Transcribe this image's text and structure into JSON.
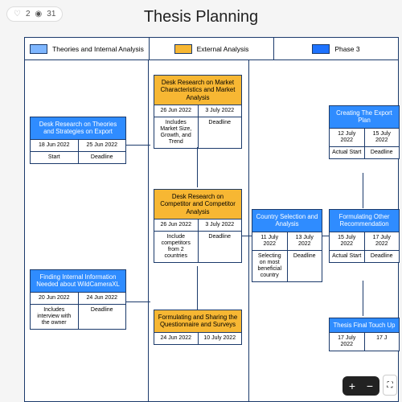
{
  "stats": {
    "likes": "2",
    "views": "31"
  },
  "title": "Thesis Planning",
  "legend": {
    "col1": "Theories and Internal Analysis",
    "col2": "External Analysis",
    "col3": "Phase 3"
  },
  "boxes": {
    "desk_export": {
      "title": "Desk Research on Theories and Strategies on Export",
      "d1": "18 Jun 2022",
      "d2": "25 Jun 2022",
      "l1": "Start",
      "l2": "Deadline"
    },
    "internal": {
      "title": "Finding Internal Information Needed about WildCameraXL",
      "d1": "20 Jun 2022",
      "d2": "24 Jun 2022",
      "l1": "Includes interview with the owner",
      "l2": "Deadline"
    },
    "market": {
      "title": "Desk Research on Market Characteristics and Market Analysis",
      "d1": "26 Jun 2022",
      "d2": "3 July 2022",
      "l1": "Includes Market Size, Growth, and Trend",
      "l2": "Deadline"
    },
    "competitor": {
      "title": "Desk Research on Competitor and Competitor Analysis",
      "d1": "26 Jun 2022",
      "d2": "3 July 2022",
      "l1": "Include competitors from 2 countries",
      "l2": "Deadline"
    },
    "survey": {
      "title": "Formulating and Sharing the Questionnaire and Surveys",
      "d1": "24 Jun 2022",
      "d2": "10 July 2022"
    },
    "country": {
      "title": "Country Selection and Analysis",
      "d1": "11 July 2022",
      "d2": "13 July 2022",
      "l1": "Selecting on most beneficial country",
      "l2": "Deadline"
    },
    "exportplan": {
      "title": "Creating The Export Plan",
      "d1": "12 July 2022",
      "d2": "15 July 2022",
      "l1": "Actual Start",
      "l2": "Deadline"
    },
    "other": {
      "title": "Formulating Other Recommendation",
      "d1": "15 July 2022",
      "d2": "17 July 2022",
      "l1": "Actual Start",
      "l2": "Deadline"
    },
    "final": {
      "title": "Thesis Final Touch Up",
      "d1": "17 July 2022",
      "d2": "17 J"
    }
  },
  "zoom": {
    "plus": "+",
    "minus": "−"
  }
}
